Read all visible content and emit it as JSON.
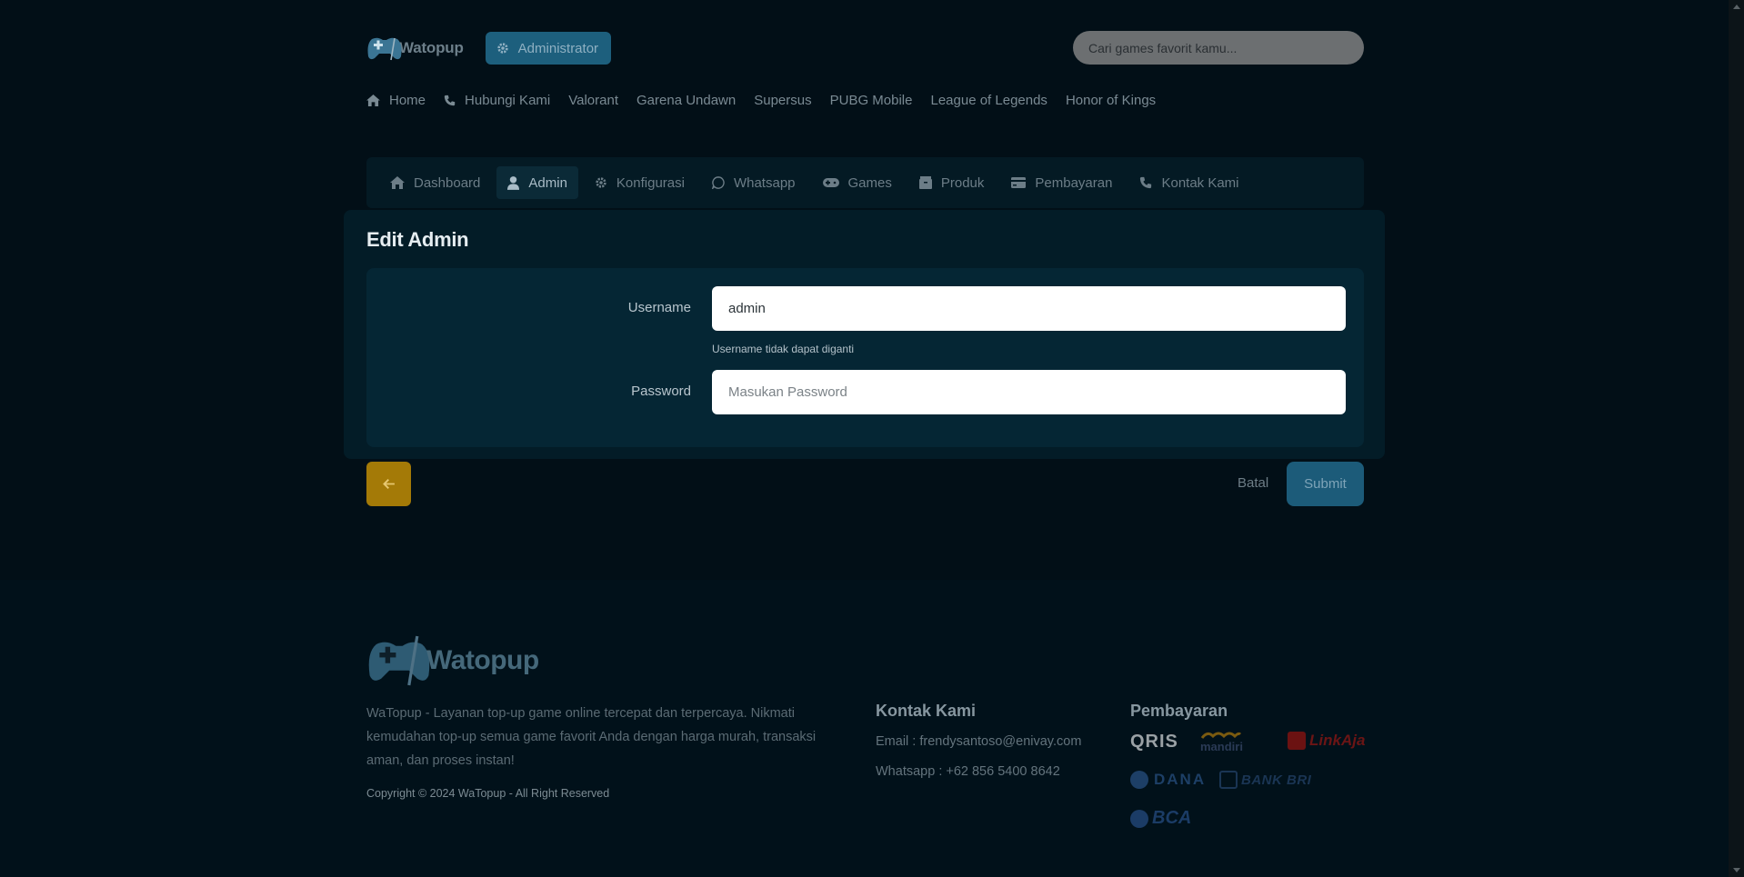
{
  "brand": {
    "name": "Watopup",
    "footer_name": "Watopup"
  },
  "header": {
    "admin_label": "Administrator",
    "search_placeholder": "Cari games favorit kamu..."
  },
  "topnav": [
    {
      "label": "Home",
      "icon": "home-icon"
    },
    {
      "label": "Hubungi Kami",
      "icon": "phone-icon"
    },
    {
      "label": "Valorant"
    },
    {
      "label": "Garena Undawn"
    },
    {
      "label": "Supersus"
    },
    {
      "label": "PUBG Mobile"
    },
    {
      "label": "League of Legends"
    },
    {
      "label": "Honor of Kings"
    }
  ],
  "tabs": [
    {
      "label": "Dashboard",
      "icon": "home-icon"
    },
    {
      "label": "Admin",
      "icon": "user-icon",
      "active": true
    },
    {
      "label": "Konfigurasi",
      "icon": "gear-icon"
    },
    {
      "label": "Whatsapp",
      "icon": "whatsapp-icon"
    },
    {
      "label": "Games",
      "icon": "gamepad-icon"
    },
    {
      "label": "Produk",
      "icon": "box-icon"
    },
    {
      "label": "Pembayaran",
      "icon": "card-icon"
    },
    {
      "label": "Kontak Kami",
      "icon": "phone-icon"
    }
  ],
  "form": {
    "title": "Edit Admin",
    "username_label": "Username",
    "username_value": "admin",
    "username_help": "Username tidak dapat diganti",
    "password_label": "Password",
    "password_placeholder": "Masukan Password"
  },
  "actions": {
    "cancel_label": "Batal",
    "submit_label": "Submit"
  },
  "footer": {
    "description": "WaTopup - Layanan top-up game online tercepat dan terpercaya. Nikmati kemudahan top-up semua game favorit Anda dengan harga murah, transaksi aman, dan proses instan!",
    "copyright": "Copyright © 2024 WaTopup - All Right Reserved",
    "contact_title": "Kontak Kami",
    "email": "Email : frendysantoso@enivay.com",
    "whatsapp": "Whatsapp : +62 856 5400 8642",
    "payment_title": "Pembayaran",
    "payments": [
      "QRIS",
      "mandiri",
      "LinkAja",
      "DANA",
      "BANK BRI",
      "BCA"
    ]
  },
  "colors": {
    "accent": "#1d5f7d",
    "back": "#a47a07",
    "background": "#020f17"
  }
}
